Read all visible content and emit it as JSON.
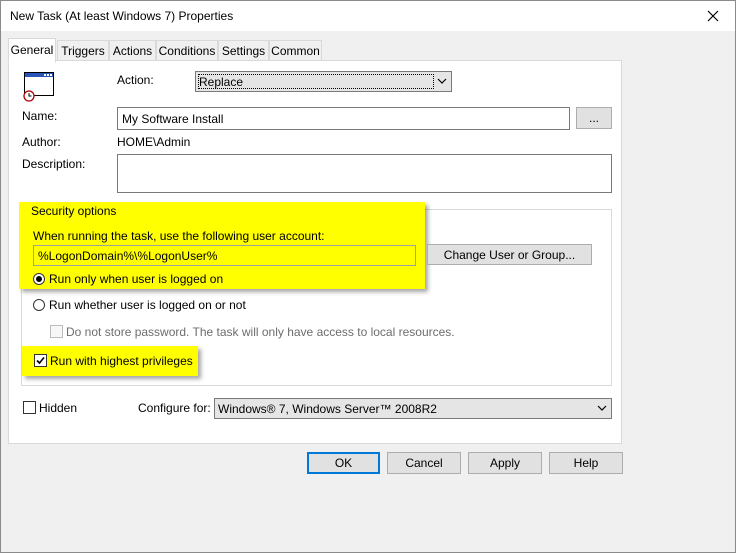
{
  "window": {
    "title": "New Task (At least Windows 7) Properties"
  },
  "tabs": [
    {
      "label": "General",
      "active": true
    },
    {
      "label": "Triggers"
    },
    {
      "label": "Actions"
    },
    {
      "label": "Conditions"
    },
    {
      "label": "Settings"
    },
    {
      "label": "Common"
    }
  ],
  "icons": {
    "task": "task-window-clock-icon",
    "close": "close-icon",
    "dropdown": "chevron-down-icon"
  },
  "general": {
    "action_label": "Action:",
    "action_value": "Replace",
    "name_label": "Name:",
    "name_value": "My Software Install",
    "browse_label": "...",
    "author_label": "Author:",
    "author_value": "HOME\\Admin",
    "description_label": "Description:",
    "description_value": ""
  },
  "security": {
    "group_title": "Security options",
    "account_label": "When running the task, use the following user account:",
    "account_value": "%LogonDomain%\\%LogonUser%",
    "change_button": "Change User or Group...",
    "radio_logged_on": "Run only when user is logged on",
    "radio_logged_on_selected": true,
    "radio_whether": "Run whether user is logged on or not",
    "no_store_password": "Do not store password. The task will only have access to local resources.",
    "no_store_password_checked": false,
    "highest_privileges": "Run with highest privileges",
    "highest_privileges_checked": true
  },
  "bottom": {
    "hidden_label": "Hidden",
    "hidden_checked": false,
    "configure_label": "Configure for:",
    "configure_value": "Windows® 7, Windows Server™ 2008R2"
  },
  "buttons": {
    "ok": "OK",
    "cancel": "Cancel",
    "apply": "Apply",
    "help": "Help"
  },
  "colors": {
    "highlight": "#ffff00",
    "accent": "#0078d7",
    "window_bg": "#f0f0f0"
  }
}
